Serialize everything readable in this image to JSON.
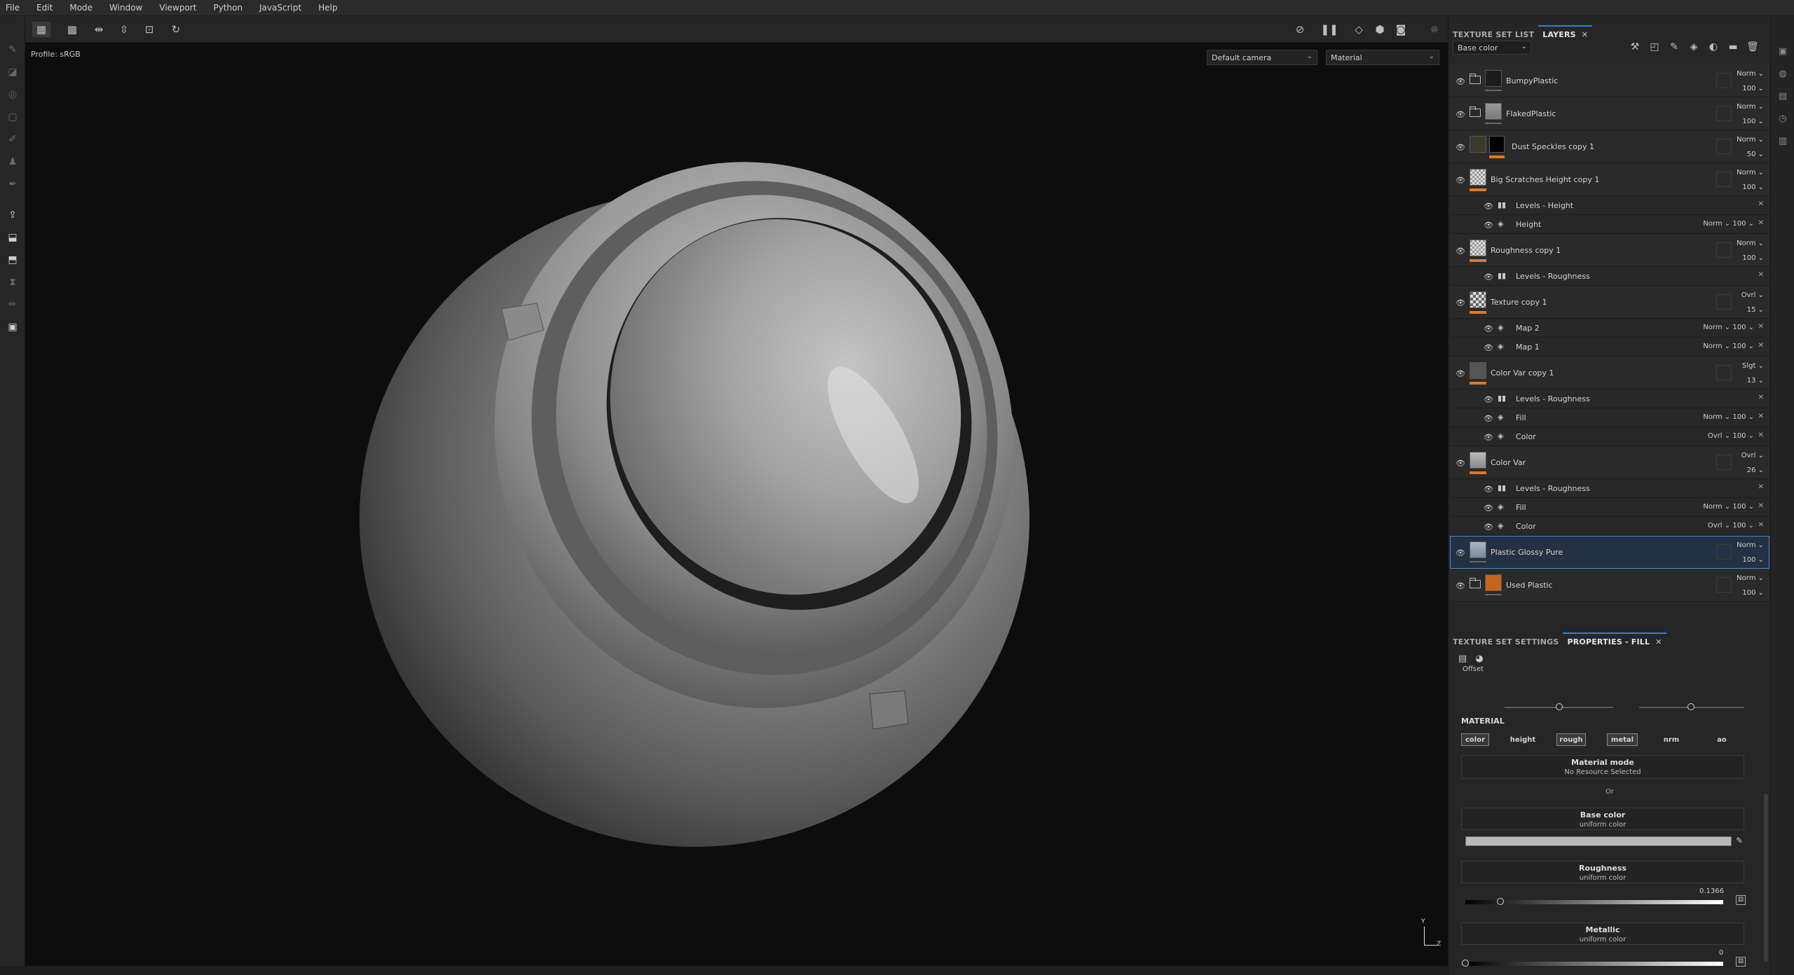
{
  "menu": [
    "File",
    "Edit",
    "Mode",
    "Window",
    "Viewport",
    "Python",
    "JavaScript",
    "Help"
  ],
  "viewport": {
    "profile": "Profile: sRGB",
    "camera": "Default camera",
    "render_mode": "Material",
    "axis_y": "Y",
    "axis_z": "Z"
  },
  "panel": {
    "tab_texture_set_list": "TEXTURE SET LIST",
    "tab_layers": "LAYERS",
    "close": "✕",
    "channel": "Base color"
  },
  "layers": [
    {
      "name": "BumpyPlastic",
      "blend": "Norm",
      "opacity": "100",
      "kind": "folder"
    },
    {
      "name": "FlakedPlastic",
      "blend": "Norm",
      "opacity": "100",
      "kind": "folder"
    },
    {
      "name": "Dust Speckles copy 1",
      "blend": "Norm",
      "opacity": "50",
      "kind": "fill-mask"
    },
    {
      "name": "Big Scratches Height copy 1",
      "blend": "Norm",
      "opacity": "100",
      "kind": "fill",
      "subs": [
        {
          "name": "Levels - Height",
          "type": "levels"
        },
        {
          "name": "Height",
          "type": "fill",
          "blend": "Norm",
          "opacity": "100"
        }
      ]
    },
    {
      "name": "Roughness copy 1",
      "blend": "Norm",
      "opacity": "100",
      "kind": "fill",
      "subs": [
        {
          "name": "Levels - Roughness",
          "type": "levels"
        }
      ]
    },
    {
      "name": "Texture copy 1",
      "blend": "Ovrl",
      "opacity": "15",
      "kind": "fill",
      "subs": [
        {
          "name": "Map 2",
          "type": "fill",
          "blend": "Norm",
          "opacity": "100"
        },
        {
          "name": "Map 1",
          "type": "fill",
          "blend": "Norm",
          "opacity": "100"
        }
      ]
    },
    {
      "name": "Color Var copy 1",
      "blend": "Slgt",
      "opacity": "13",
      "kind": "fill",
      "subs": [
        {
          "name": "Levels - Roughness",
          "type": "levels"
        },
        {
          "name": "Fill",
          "type": "fill",
          "blend": "Norm",
          "opacity": "100"
        },
        {
          "name": "Color",
          "type": "fill",
          "blend": "Ovrl",
          "opacity": "100"
        }
      ]
    },
    {
      "name": "Color Var",
      "blend": "Ovrl",
      "opacity": "26",
      "kind": "fill",
      "subs": [
        {
          "name": "Levels - Roughness",
          "type": "levels"
        },
        {
          "name": "Fill",
          "type": "fill",
          "blend": "Norm",
          "opacity": "100"
        },
        {
          "name": "Color",
          "type": "fill",
          "blend": "Ovrl",
          "opacity": "100"
        }
      ]
    },
    {
      "name": "Plastic Glossy Pure",
      "blend": "Norm",
      "opacity": "100",
      "kind": "fill",
      "selected": true
    },
    {
      "name": "Used Plastic",
      "blend": "Norm",
      "opacity": "100",
      "kind": "folder-orange"
    }
  ],
  "properties": {
    "tab_settings": "TEXTURE SET SETTINGS",
    "tab_fill": "PROPERTIES - FILL",
    "offset_label": "Offset",
    "material_label": "MATERIAL",
    "channels": [
      "color",
      "height",
      "rough",
      "metal",
      "nrm",
      "ao"
    ],
    "material_mode_title": "Material mode",
    "material_mode_value": "No Resource Selected",
    "or_label": "Or",
    "base_color_title": "Base color",
    "base_color_sub": "uniform color",
    "roughness_title": "Roughness",
    "roughness_sub": "uniform color",
    "roughness_value": "0.1366",
    "roughness_level": 0.1366,
    "metallic_title": "Metallic",
    "metallic_sub": "uniform color",
    "metallic_value": "0",
    "metallic_level": 0
  },
  "colors": {
    "accent": "#2f7fd8",
    "layer_bar": "#e07820",
    "selected_bg": "#243142"
  }
}
